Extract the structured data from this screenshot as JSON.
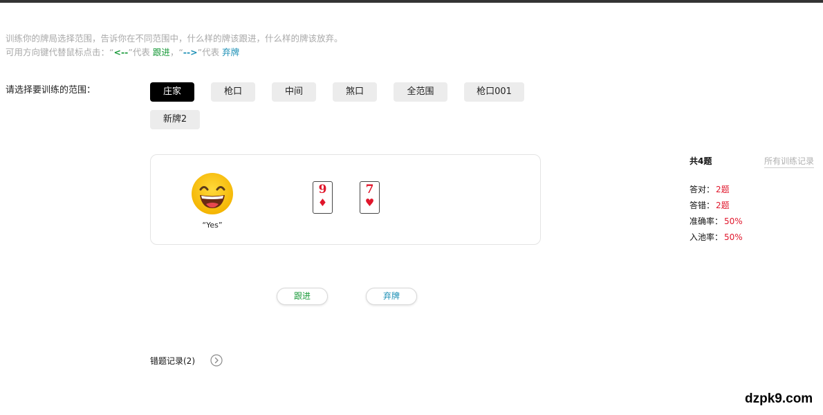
{
  "intro": {
    "line1": "训练你的牌局选择范围，告诉你在不同范围中，什么样的牌该跟进，什么样的牌该放弃。",
    "line2_prefix": "可用方向键代替鼠标点击：“",
    "arrow_follow": "<--",
    "line2_mid1": "”代表 ",
    "word_follow": "跟进",
    "line2_mid2": "，“",
    "arrow_fold": "-->",
    "line2_mid3": "”代表 ",
    "word_fold": "弃牌"
  },
  "range": {
    "label": "请选择要训练的范围：",
    "options": [
      {
        "label": "庄家",
        "active": true
      },
      {
        "label": "枪口",
        "active": false
      },
      {
        "label": "中间",
        "active": false
      },
      {
        "label": "煞口",
        "active": false
      },
      {
        "label": "全范围",
        "active": false
      },
      {
        "label": "枪口001",
        "active": false
      },
      {
        "label": "新牌2",
        "active": false
      }
    ]
  },
  "hand": {
    "emoji": "laughing-face-icon",
    "caption": "“Yes”",
    "cards": [
      {
        "rank": "9",
        "suit": "♦",
        "suit_name": "diamond-icon"
      },
      {
        "rank": "7",
        "suit": "♥",
        "suit_name": "heart-icon"
      }
    ]
  },
  "stats": {
    "total": "共4题",
    "all_records": "所有训练记录",
    "rows": [
      {
        "label": "答对：",
        "value": "2题"
      },
      {
        "label": "答错：",
        "value": "2题"
      },
      {
        "label": "准确率：",
        "value": "50%"
      },
      {
        "label": "入池率：",
        "value": "50%"
      }
    ]
  },
  "actions": {
    "follow": "跟进",
    "fold": "弃牌"
  },
  "wrong_records": {
    "label": "错题记录(2)"
  },
  "watermark": "dzpk9.com",
  "colors": {
    "follow": "#1a9a3a",
    "fold": "#1b8fb5",
    "red": "#e0162b",
    "active_bg": "#000000",
    "button_bg": "#ececec"
  }
}
